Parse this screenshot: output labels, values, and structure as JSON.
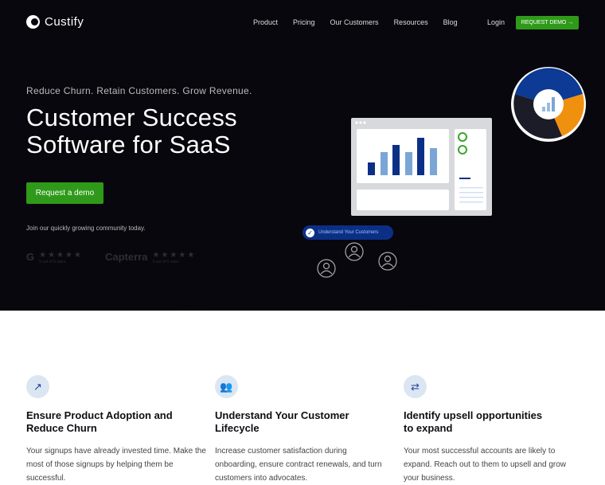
{
  "header": {
    "brand": "Custify",
    "nav": [
      "Product",
      "Pricing",
      "Our Customers",
      "Resources",
      "Blog"
    ],
    "login": "Login",
    "request_demo": "REQUEST DEMO →"
  },
  "hero": {
    "tagline": "Reduce Churn. Retain Customers. Grow Revenue.",
    "title_line1": "Customer Success",
    "title_line2": "Software for SaaS",
    "cta": "Request a demo",
    "join": "Join our quickly growing community today.",
    "ratings": [
      {
        "brand": "G2",
        "stars": 5,
        "caption": "5 out of 5 stars"
      },
      {
        "brand": "Capterra",
        "stars": 5,
        "caption": "5 out of 5 stars"
      }
    ],
    "badge": "Understand Your Customers"
  },
  "colors": {
    "background": "#07070d",
    "accent": "#2f9a1a",
    "blue": "#0c2f86",
    "orange": "#f0900f"
  },
  "features": [
    {
      "icon": "trending-up-icon",
      "title": "Ensure Product Adoption and Reduce Churn",
      "text": "Your signups have already invested time. Make the most of those signups by helping them be successful."
    },
    {
      "icon": "users-icon",
      "title": "Understand Your Customer Lifecycle",
      "text": "Increase customer satisfaction during onboarding, ensure contract renewals, and turn customers into advocates."
    },
    {
      "icon": "sparkle-arrow-icon",
      "title": "Identify upsell opportunities to expand",
      "text": "Your most successful accounts are likely to expand. Reach out to them to upsell and grow your business."
    }
  ]
}
